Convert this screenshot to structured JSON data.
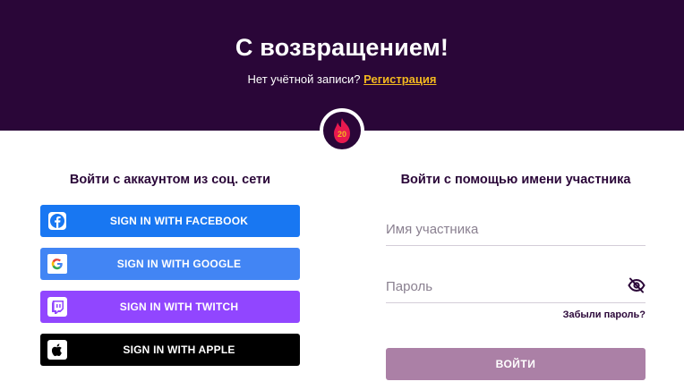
{
  "header": {
    "title": "С возвращением!",
    "no_account_text": "Нет учётной записи?",
    "register_link": "Регистрация"
  },
  "badge": {
    "icon": "flame-level-icon",
    "level": "20",
    "colors": {
      "flame": "#e8194f",
      "level_text": "#f3b91f"
    }
  },
  "social": {
    "heading": "Войти с аккаунтом из соц. сети",
    "buttons": [
      {
        "id": "facebook",
        "label": "SIGN IN WITH FACEBOOK",
        "icon": "facebook-icon",
        "color": "#1877f2"
      },
      {
        "id": "google",
        "label": "SIGN IN WITH GOOGLE",
        "icon": "google-icon",
        "color": "#4285f4"
      },
      {
        "id": "twitch",
        "label": "SIGN IN WITH TWITCH",
        "icon": "twitch-icon",
        "color": "#9146ff"
      },
      {
        "id": "apple",
        "label": "SIGN IN WITH APPLE",
        "icon": "apple-icon",
        "color": "#000000"
      }
    ]
  },
  "login_form": {
    "heading": "Войти с помощью имени участника",
    "username": {
      "value": "",
      "placeholder": "Имя участника"
    },
    "password": {
      "value": "",
      "placeholder": "Пароль",
      "toggle_icon": "eye-slash-icon"
    },
    "forgot_link": "Забыли пароль?",
    "submit_label": "ВОЙТИ"
  },
  "theme": {
    "header_bg": "#2a0638",
    "accent": "#f3b91f",
    "submit_bg": "#ab80a6"
  }
}
